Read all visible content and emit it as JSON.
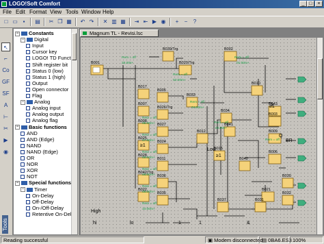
{
  "window": {
    "title": "LOGO!Soft Comfort",
    "minimize": "_",
    "maximize": "□",
    "close": "×"
  },
  "menu": [
    "File",
    "Edit",
    "Format",
    "View",
    "Tools",
    "Window",
    "Help"
  ],
  "tree": {
    "rows": [
      {
        "label": "Constants",
        "level": 0,
        "type": "root"
      },
      {
        "label": "Digital",
        "level": 1,
        "type": "folder"
      },
      {
        "label": "Input",
        "level": 2,
        "type": "item"
      },
      {
        "label": "Cursor key",
        "level": 2,
        "type": "item"
      },
      {
        "label": "LOGO! TD Functio",
        "level": 2,
        "type": "item"
      },
      {
        "label": "Shift register bit",
        "level": 2,
        "type": "item"
      },
      {
        "label": "Status 0 (low)",
        "level": 2,
        "type": "item"
      },
      {
        "label": "Status 1 (high)",
        "level": 2,
        "type": "item"
      },
      {
        "label": "Output",
        "level": 2,
        "type": "item"
      },
      {
        "label": "Open connector",
        "level": 2,
        "type": "item"
      },
      {
        "label": "Flag",
        "level": 2,
        "type": "item"
      },
      {
        "label": "Analog",
        "level": 1,
        "type": "folder"
      },
      {
        "label": "Analog input",
        "level": 2,
        "type": "item"
      },
      {
        "label": "Analog output",
        "level": 2,
        "type": "item"
      },
      {
        "label": "Analog flag",
        "level": 2,
        "type": "item"
      },
      {
        "label": "Basic functions",
        "level": 0,
        "type": "root"
      },
      {
        "label": "AND",
        "level": 1,
        "type": "item"
      },
      {
        "label": "AND (Edge)",
        "level": 1,
        "type": "item"
      },
      {
        "label": "NAND",
        "level": 1,
        "type": "item"
      },
      {
        "label": "NAND (Edge)",
        "level": 1,
        "type": "item"
      },
      {
        "label": "OR",
        "level": 1,
        "type": "item"
      },
      {
        "label": "NOR",
        "level": 1,
        "type": "item"
      },
      {
        "label": "XOR",
        "level": 1,
        "type": "item"
      },
      {
        "label": "NOT",
        "level": 1,
        "type": "item"
      },
      {
        "label": "Special functions",
        "level": 0,
        "type": "root"
      },
      {
        "label": "Timer",
        "level": 1,
        "type": "folder"
      },
      {
        "label": "On-Delay",
        "level": 2,
        "type": "item"
      },
      {
        "label": "Off-Delay",
        "level": 2,
        "type": "item"
      },
      {
        "label": "On-/Off-Delay",
        "level": 2,
        "type": "item"
      },
      {
        "label": "Retentive On-Del",
        "level": 2,
        "type": "item"
      }
    ]
  },
  "tools_label": "Tools",
  "document": {
    "tab_title": "Magnum TL - Revisi.lsc"
  },
  "diagram": {
    "blocks": [
      {
        "id": "B001",
        "sym": "",
        "kind": "input"
      },
      {
        "id": "B039/Trg",
        "sym": "",
        "kind": "label"
      },
      {
        "id": "B020/Trg",
        "sym": "",
        "kind": "label"
      },
      {
        "id": "B002",
        "sym": "",
        "kind": "gate"
      },
      {
        "id": "B017",
        "sym": "",
        "kind": "gate"
      },
      {
        "id": "B007",
        "sym": "",
        "kind": "gate"
      },
      {
        "id": "B008",
        "sym": "",
        "kind": "gate"
      },
      {
        "id": "B025",
        "sym": "≥1",
        "kind": "gate"
      },
      {
        "id": "B028",
        "sym": "",
        "kind": "gate"
      },
      {
        "id": "B042/Trg",
        "sym": "",
        "kind": "label"
      },
      {
        "id": "B022",
        "sym": "",
        "kind": "gate"
      },
      {
        "id": "B005",
        "sym": "",
        "kind": "gate"
      },
      {
        "id": "B026/Trg",
        "sym": "",
        "kind": "label"
      },
      {
        "id": "B027",
        "sym": "",
        "kind": "gate"
      },
      {
        "id": "B024",
        "sym": "",
        "kind": "gate"
      },
      {
        "id": "B011",
        "sym": "",
        "kind": "gate"
      },
      {
        "id": "B036",
        "sym": "",
        "kind": "gate"
      },
      {
        "id": "B035",
        "sym": "",
        "kind": "gate"
      },
      {
        "id": "B033",
        "sym": "",
        "kind": "gate"
      },
      {
        "id": "B012",
        "sym": "",
        "kind": "gate"
      },
      {
        "id": "B015",
        "sym": "≥1",
        "kind": "gate"
      },
      {
        "id": "B034",
        "sym": "",
        "kind": "gate"
      },
      {
        "id": "B041",
        "sym": "",
        "kind": "gate"
      },
      {
        "id": "B040",
        "sym": "",
        "kind": "gate"
      },
      {
        "id": "B010",
        "sym": "",
        "kind": "gate"
      },
      {
        "id": "B043",
        "sym": "",
        "kind": "gate"
      },
      {
        "id": "B003",
        "sym": "",
        "kind": "gate"
      },
      {
        "id": "B009",
        "sym": "",
        "kind": "gate"
      },
      {
        "id": "B006",
        "sym": "",
        "kind": "gate"
      },
      {
        "id": "B021",
        "sym": "",
        "kind": "gate"
      },
      {
        "id": "B030",
        "sym": "",
        "kind": "gate"
      },
      {
        "id": "B032",
        "sym": "",
        "kind": "gate"
      },
      {
        "id": "B031",
        "sym": "",
        "kind": "gate"
      },
      {
        "id": "B037",
        "sym": "",
        "kind": "gate"
      }
    ],
    "remanence_labels": [
      "Rem = off",
      "25.00s+",
      "Rem = off",
      "01:00m+",
      "Rem = off",
      "02:00m+",
      "Rem = off",
      "04:00m+",
      "Rem = off",
      "05:00m+",
      "Rem = off",
      "07:00m+",
      "Rem = off",
      "09:00m+",
      "Rem = off",
      "06:00m+",
      "Rem = off",
      "08:00m+",
      "Rem = off",
      "10:00m+",
      "Rem = off",
      "02:00s+",
      "Rem = off"
    ],
    "text_labels": [
      "Low",
      "High",
      "hi",
      "Q",
      "BR",
      "lo",
      "≥1",
      "1",
      "1",
      "&"
    ]
  },
  "status": {
    "message": "Reading successful",
    "modem": "Modem disconnected",
    "device": "0BA6.ES3",
    "zoom": "100%"
  }
}
